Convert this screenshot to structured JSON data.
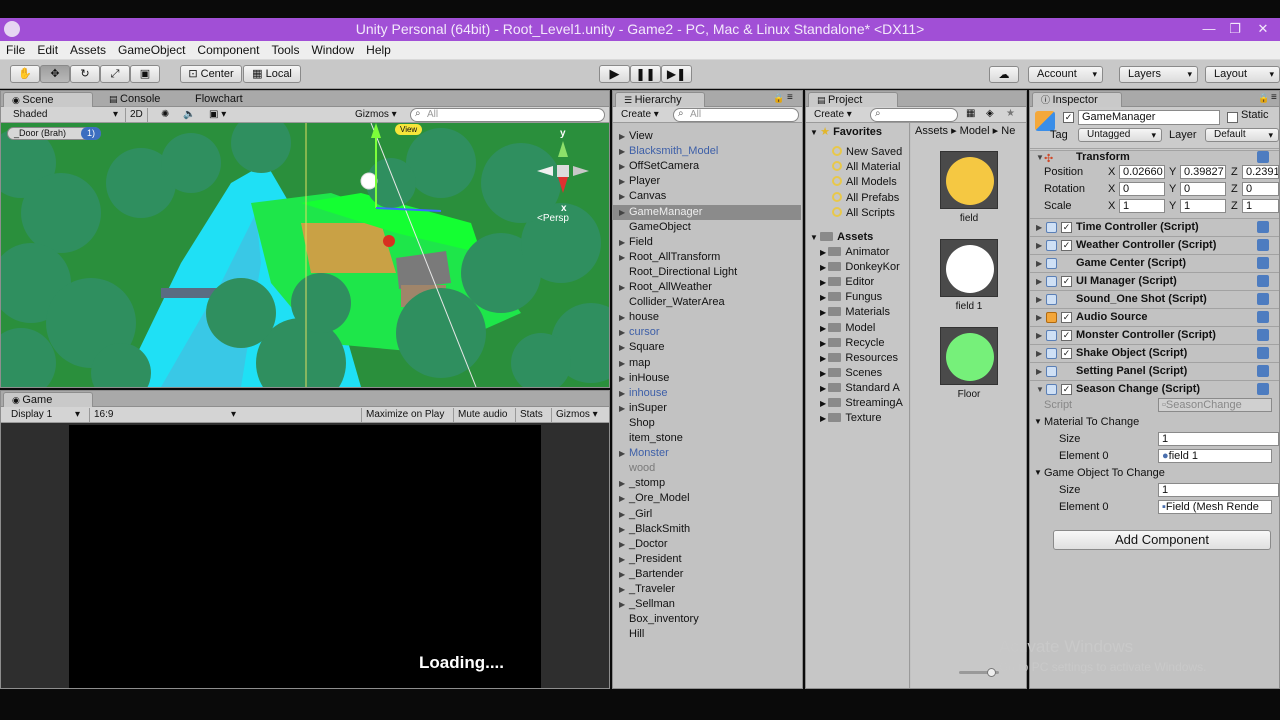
{
  "window": {
    "title": "Unity Personal (64bit) - Root_Level1.unity - Game2 - PC, Mac & Linux Standalone* <DX11>",
    "controls": [
      "—",
      "❐",
      "✕"
    ]
  },
  "menu": [
    "File",
    "Edit",
    "Assets",
    "GameObject",
    "Component",
    "Tools",
    "Window",
    "Help"
  ],
  "toolbar": {
    "pivot_label": "Center",
    "space_label": "Local",
    "account_label": "Account",
    "layers_label": "Layers",
    "layout_label": "Layout"
  },
  "scene": {
    "tabs": [
      "Scene",
      "Console",
      "Flowchart"
    ],
    "shading_mode": "Shaded",
    "mode_2d": "2D",
    "gizmos_label": "Gizmos",
    "search_placeholder": "All",
    "object_tag": "_Door (Brah)",
    "object_tag_count": "1)",
    "view_label": "View",
    "persp_label": "Persp",
    "axis_y": "y",
    "axis_x": "x"
  },
  "game": {
    "tab": "Game",
    "display": "Display 1",
    "aspect": "16:9",
    "maximize_on_play": "Maximize on Play",
    "mute_audio": "Mute audio",
    "stats": "Stats",
    "gizmos_label": "Gizmos",
    "loading_text": "Loading...."
  },
  "hierarchy": {
    "tab": "Hierarchy",
    "create_label": "Create",
    "search_placeholder": "All",
    "items": [
      {
        "label": "View",
        "style": "normal",
        "arrow": "▶"
      },
      {
        "label": "Blacksmith_Model",
        "style": "blue",
        "arrow": "▶"
      },
      {
        "label": "OffSetCamera",
        "style": "normal",
        "arrow": "▶"
      },
      {
        "label": "Player",
        "style": "normal",
        "arrow": "▶"
      },
      {
        "label": "Canvas",
        "style": "normal",
        "arrow": "▶"
      },
      {
        "label": "GameManager",
        "style": "selected",
        "arrow": "▶"
      },
      {
        "label": "GameObject",
        "style": "normal",
        "arrow": ""
      },
      {
        "label": "Field",
        "style": "normal",
        "arrow": "▶"
      },
      {
        "label": "Root_AllTransform",
        "style": "normal",
        "arrow": "▶"
      },
      {
        "label": "Root_Directional Light",
        "style": "normal",
        "arrow": ""
      },
      {
        "label": "Root_AllWeather",
        "style": "normal",
        "arrow": "▶"
      },
      {
        "label": "Collider_WaterArea",
        "style": "normal",
        "arrow": ""
      },
      {
        "label": "house",
        "style": "normal",
        "arrow": "▶"
      },
      {
        "label": "cursor",
        "style": "blue",
        "arrow": "▶"
      },
      {
        "label": "Square",
        "style": "normal",
        "arrow": "▶"
      },
      {
        "label": "map",
        "style": "normal",
        "arrow": "▶"
      },
      {
        "label": "inHouse",
        "style": "normal",
        "arrow": "▶"
      },
      {
        "label": "inhouse",
        "style": "blue",
        "arrow": "▶"
      },
      {
        "label": "inSuper",
        "style": "normal",
        "arrow": "▶"
      },
      {
        "label": "Shop",
        "style": "normal",
        "arrow": ""
      },
      {
        "label": "item_stone",
        "style": "normal",
        "arrow": ""
      },
      {
        "label": "Monster",
        "style": "blue",
        "arrow": "▶"
      },
      {
        "label": "wood",
        "style": "grey",
        "arrow": ""
      },
      {
        "label": "_stomp",
        "style": "normal",
        "arrow": "▶"
      },
      {
        "label": "_Ore_Model",
        "style": "normal",
        "arrow": "▶"
      },
      {
        "label": "_Girl",
        "style": "normal",
        "arrow": "▶"
      },
      {
        "label": "_BlackSmith",
        "style": "normal",
        "arrow": "▶"
      },
      {
        "label": "_Doctor",
        "style": "normal",
        "arrow": "▶"
      },
      {
        "label": "_President",
        "style": "normal",
        "arrow": "▶"
      },
      {
        "label": "_Bartender",
        "style": "normal",
        "arrow": "▶"
      },
      {
        "label": "_Traveler",
        "style": "normal",
        "arrow": "▶"
      },
      {
        "label": "_Sellman",
        "style": "normal",
        "arrow": "▶"
      },
      {
        "label": "Box_inventory",
        "style": "normal",
        "arrow": ""
      },
      {
        "label": "Hill",
        "style": "normal",
        "arrow": ""
      }
    ]
  },
  "project": {
    "tab": "Project",
    "create_label": "Create",
    "favorites_label": "Favorites",
    "favorites": [
      "New Saved",
      "All Material",
      "All Models",
      "All Prefabs",
      "All Scripts"
    ],
    "assets_label": "Assets",
    "folders": [
      "Animator",
      "DonkeyKor",
      "Editor",
      "Fungus",
      "Materials",
      "Model",
      "Recycle",
      "Resources",
      "Scenes",
      "Standard A",
      "StreamingA",
      "Texture"
    ],
    "breadcrumb": [
      "Assets",
      "Model",
      "Ne"
    ],
    "assets": [
      {
        "name": "field",
        "color": "#f5c842"
      },
      {
        "name": "field 1",
        "color": "#ffffff"
      },
      {
        "name": "Floor",
        "color": "#76f07a"
      }
    ]
  },
  "inspector": {
    "tab": "Inspector",
    "object_name": "GameManager",
    "static_label": "Static",
    "tag_label": "Tag",
    "tag_value": "Untagged",
    "layer_label": "Layer",
    "layer_value": "Default",
    "transform": {
      "title": "Transform",
      "position_label": "Position",
      "rotation_label": "Rotation",
      "scale_label": "Scale",
      "position": [
        "0.02660",
        "0.39827",
        "0.2391"
      ],
      "rotation": [
        "0",
        "0",
        "0"
      ],
      "scale": [
        "1",
        "1",
        "1"
      ]
    },
    "components": [
      {
        "name": "Time Controller (Script)",
        "checked": true
      },
      {
        "name": "Weather Controller (Script)",
        "checked": true
      },
      {
        "name": "Game Center (Script)",
        "checked": false
      },
      {
        "name": "UI Manager (Script)",
        "checked": true
      },
      {
        "name": "Sound_One Shot (Script)",
        "checked": false
      },
      {
        "name": "Audio Source",
        "checked": true
      },
      {
        "name": "Monster Controller (Script)",
        "checked": true
      },
      {
        "name": "Shake Object (Script)",
        "checked": true
      },
      {
        "name": "Setting Panel (Script)",
        "checked": false
      },
      {
        "name": "Season Change (Script)",
        "checked": true
      }
    ],
    "season": {
      "script_label": "Script",
      "script_value": "SeasonChange",
      "mat_header": "Material To Change",
      "size_label": "Size",
      "mat_size": "1",
      "element_label": "Element 0",
      "mat_element": "field 1",
      "go_header": "Game Object To Change",
      "go_size": "1",
      "go_element": "Field (Mesh Rende"
    },
    "add_component": "Add Component"
  },
  "watermark": {
    "line1": "Activate Windows",
    "line2": "Go to PC settings to activate Windows."
  }
}
